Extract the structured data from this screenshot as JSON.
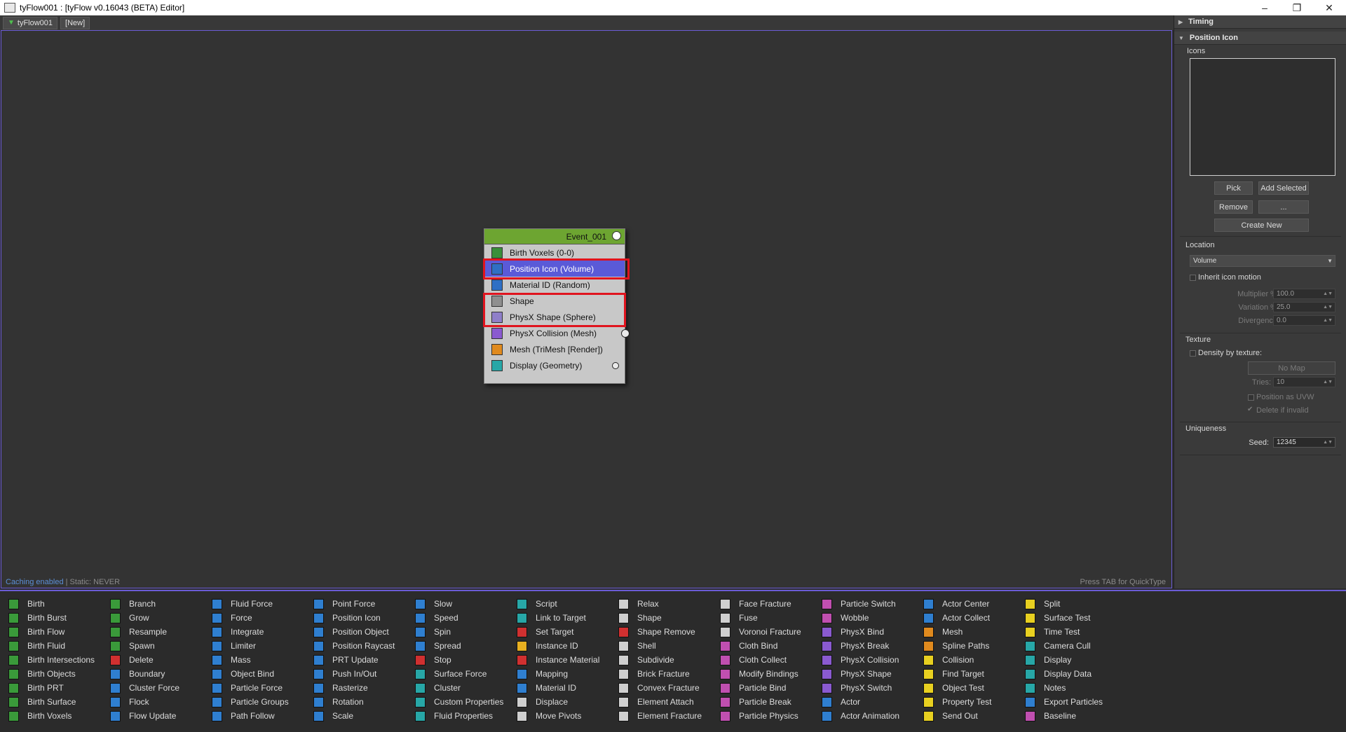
{
  "window": {
    "title": "tyFlow001 : [tyFlow v0.16043 (BETA) Editor]",
    "controls": [
      "–",
      "❐",
      "✕"
    ]
  },
  "tabs": [
    {
      "label": "tyFlow001",
      "icon": "down-arrow-icon"
    },
    {
      "label": "[New]"
    }
  ],
  "canvas": {
    "status_cache": "Caching enabled",
    "status_static": " | Static: NEVER",
    "hint": "Press TAB for QuickType"
  },
  "event": {
    "name": "Event_001",
    "operators": [
      {
        "label": "Birth Voxels (0-0)",
        "color": "#3a8f3a",
        "selected": false
      },
      {
        "label": "Position Icon (Volume)",
        "color": "#2f6fc4",
        "selected": true
      },
      {
        "label": "Material ID (Random)",
        "color": "#2f6fc4",
        "selected": false
      },
      {
        "label": "Shape",
        "color": "#8f8f8f",
        "selected": false
      },
      {
        "label": "PhysX Shape (Sphere)",
        "color": "#8f7fc9",
        "selected": false
      },
      {
        "label": "PhysX Collision (Mesh)",
        "color": "#8a5ad0",
        "selected": false
      },
      {
        "label": "Mesh (TriMesh [Render])",
        "color": "#e08a1e",
        "selected": false
      },
      {
        "label": "Display (Geometry)",
        "color": "#27a7a7",
        "selected": false
      }
    ]
  },
  "panel": {
    "timing": "Timing",
    "position_icon": "Position Icon",
    "icons_label": "Icons",
    "pick": "Pick",
    "add_selected": "Add Selected",
    "remove": "Remove",
    "dots": "...",
    "create_new": "Create New",
    "location_label": "Location",
    "location_value": "Volume",
    "inherit_motion": "Inherit icon motion",
    "multiplier_label": "Multiplier %:",
    "multiplier_value": "100.0",
    "variation_label": "Variation %:",
    "variation_value": "25.0",
    "divergence_label": "Divergence:",
    "divergence_value": "0.0",
    "texture_label": "Texture",
    "density_by_texture": "Density by texture:",
    "no_map": "No Map",
    "tries_label": "Tries:",
    "tries_value": "10",
    "position_as_uvw": "Position as UVW",
    "delete_if_invalid": "Delete if invalid",
    "uniqueness_label": "Uniqueness",
    "seed_label": "Seed:",
    "seed_value": "12345"
  },
  "palette": {
    "columns": [
      [
        {
          "label": "Birth",
          "color": "#3a9a3a"
        },
        {
          "label": "Birth Burst",
          "color": "#3a9a3a"
        },
        {
          "label": "Birth Flow",
          "color": "#3a9a3a"
        },
        {
          "label": "Birth Fluid",
          "color": "#3a9a3a"
        },
        {
          "label": "Birth Intersections",
          "color": "#3a9a3a"
        },
        {
          "label": "Birth Objects",
          "color": "#3a9a3a"
        },
        {
          "label": "Birth PRT",
          "color": "#3a9a3a"
        },
        {
          "label": "Birth Surface",
          "color": "#3a9a3a"
        },
        {
          "label": "Birth Voxels",
          "color": "#3a9a3a"
        }
      ],
      [
        {
          "label": "Branch",
          "color": "#3a9a3a"
        },
        {
          "label": "Grow",
          "color": "#3a9a3a"
        },
        {
          "label": "Resample",
          "color": "#3a9a3a"
        },
        {
          "label": "Spawn",
          "color": "#3a9a3a"
        },
        {
          "label": "Delete",
          "color": "#d03030"
        },
        {
          "label": "Boundary",
          "color": "#2f7fd0"
        },
        {
          "label": "Cluster Force",
          "color": "#2f7fd0"
        },
        {
          "label": "Flock",
          "color": "#2f7fd0"
        },
        {
          "label": "Flow Update",
          "color": "#2f7fd0"
        }
      ],
      [
        {
          "label": "Fluid Force",
          "color": "#2f7fd0"
        },
        {
          "label": "Force",
          "color": "#2f7fd0"
        },
        {
          "label": "Integrate",
          "color": "#2f7fd0"
        },
        {
          "label": "Limiter",
          "color": "#2f7fd0"
        },
        {
          "label": "Mass",
          "color": "#2f7fd0"
        },
        {
          "label": "Object Bind",
          "color": "#2f7fd0"
        },
        {
          "label": "Particle Force",
          "color": "#2f7fd0"
        },
        {
          "label": "Particle Groups",
          "color": "#2f7fd0"
        },
        {
          "label": "Path Follow",
          "color": "#2f7fd0"
        }
      ],
      [
        {
          "label": "Point Force",
          "color": "#2f7fd0"
        },
        {
          "label": "Position Icon",
          "color": "#2f7fd0"
        },
        {
          "label": "Position Object",
          "color": "#2f7fd0"
        },
        {
          "label": "Position Raycast",
          "color": "#2f7fd0"
        },
        {
          "label": "PRT Update",
          "color": "#2f7fd0"
        },
        {
          "label": "Push In/Out",
          "color": "#2f7fd0"
        },
        {
          "label": "Rasterize",
          "color": "#2f7fd0"
        },
        {
          "label": "Rotation",
          "color": "#2f7fd0"
        },
        {
          "label": "Scale",
          "color": "#2f7fd0"
        }
      ],
      [
        {
          "label": "Slow",
          "color": "#2f7fd0"
        },
        {
          "label": "Speed",
          "color": "#2f7fd0"
        },
        {
          "label": "Spin",
          "color": "#2f7fd0"
        },
        {
          "label": "Spread",
          "color": "#2f7fd0"
        },
        {
          "label": "Stop",
          "color": "#d03030"
        },
        {
          "label": "Surface Force",
          "color": "#27a7a7"
        },
        {
          "label": "Cluster",
          "color": "#27a7a7"
        },
        {
          "label": "Custom Properties",
          "color": "#27a7a7"
        },
        {
          "label": "Fluid Properties",
          "color": "#27a7a7"
        }
      ],
      [
        {
          "label": "Script",
          "color": "#27a7a7"
        },
        {
          "label": "Link to Target",
          "color": "#27a7a7"
        },
        {
          "label": "Set Target",
          "color": "#d03030"
        },
        {
          "label": "Instance ID",
          "color": "#e8b020"
        },
        {
          "label": "Instance Material",
          "color": "#d03030"
        },
        {
          "label": "Mapping",
          "color": "#2f7fd0"
        },
        {
          "label": "Material ID",
          "color": "#2f7fd0"
        },
        {
          "label": "Displace",
          "color": "#cfcfcf"
        },
        {
          "label": "Move Pivots",
          "color": "#cfcfcf"
        }
      ],
      [
        {
          "label": "Relax",
          "color": "#cfcfcf"
        },
        {
          "label": "Shape",
          "color": "#cfcfcf"
        },
        {
          "label": "Shape Remove",
          "color": "#d03030"
        },
        {
          "label": "Shell",
          "color": "#cfcfcf"
        },
        {
          "label": "Subdivide",
          "color": "#cfcfcf"
        },
        {
          "label": "Brick Fracture",
          "color": "#cfcfcf"
        },
        {
          "label": "Convex Fracture",
          "color": "#cfcfcf"
        },
        {
          "label": "Element Attach",
          "color": "#cfcfcf"
        },
        {
          "label": "Element Fracture",
          "color": "#cfcfcf"
        }
      ],
      [
        {
          "label": "Face Fracture",
          "color": "#cfcfcf"
        },
        {
          "label": "Fuse",
          "color": "#cfcfcf"
        },
        {
          "label": "Voronoi Fracture",
          "color": "#cfcfcf"
        },
        {
          "label": "Cloth Bind",
          "color": "#c04fb0"
        },
        {
          "label": "Cloth Collect",
          "color": "#c04fb0"
        },
        {
          "label": "Modify Bindings",
          "color": "#c04fb0"
        },
        {
          "label": "Particle Bind",
          "color": "#c04fb0"
        },
        {
          "label": "Particle Break",
          "color": "#c04fb0"
        },
        {
          "label": "Particle Physics",
          "color": "#c04fb0"
        }
      ],
      [
        {
          "label": "Particle Switch",
          "color": "#c04fb0"
        },
        {
          "label": "Wobble",
          "color": "#c04fb0"
        },
        {
          "label": "PhysX Bind",
          "color": "#8a5ad0"
        },
        {
          "label": "PhysX Break",
          "color": "#8a5ad0"
        },
        {
          "label": "PhysX Collision",
          "color": "#8a5ad0"
        },
        {
          "label": "PhysX Shape",
          "color": "#8a5ad0"
        },
        {
          "label": "PhysX Switch",
          "color": "#8a5ad0"
        },
        {
          "label": "Actor",
          "color": "#2f7fd0"
        },
        {
          "label": "Actor Animation",
          "color": "#2f7fd0"
        }
      ],
      [
        {
          "label": "Actor Center",
          "color": "#2f7fd0"
        },
        {
          "label": "Actor Collect",
          "color": "#2f7fd0"
        },
        {
          "label": "Mesh",
          "color": "#e08a1e"
        },
        {
          "label": "Spline Paths",
          "color": "#e08a1e"
        },
        {
          "label": "Collision",
          "color": "#e8d020"
        },
        {
          "label": "Find Target",
          "color": "#e8d020"
        },
        {
          "label": "Object Test",
          "color": "#e8d020"
        },
        {
          "label": "Property Test",
          "color": "#e8d020"
        },
        {
          "label": "Send Out",
          "color": "#e8d020"
        }
      ],
      [
        {
          "label": "Split",
          "color": "#e8d020"
        },
        {
          "label": "Surface Test",
          "color": "#e8d020"
        },
        {
          "label": "Time Test",
          "color": "#e8d020"
        },
        {
          "label": "Camera Cull",
          "color": "#27a7a7"
        },
        {
          "label": "Display",
          "color": "#27a7a7"
        },
        {
          "label": "Display Data",
          "color": "#27a7a7"
        },
        {
          "label": "Notes",
          "color": "#27a7a7"
        },
        {
          "label": "Export Particles",
          "color": "#2f7fd0"
        },
        {
          "label": "Baseline",
          "color": "#c04fb0"
        }
      ]
    ]
  }
}
